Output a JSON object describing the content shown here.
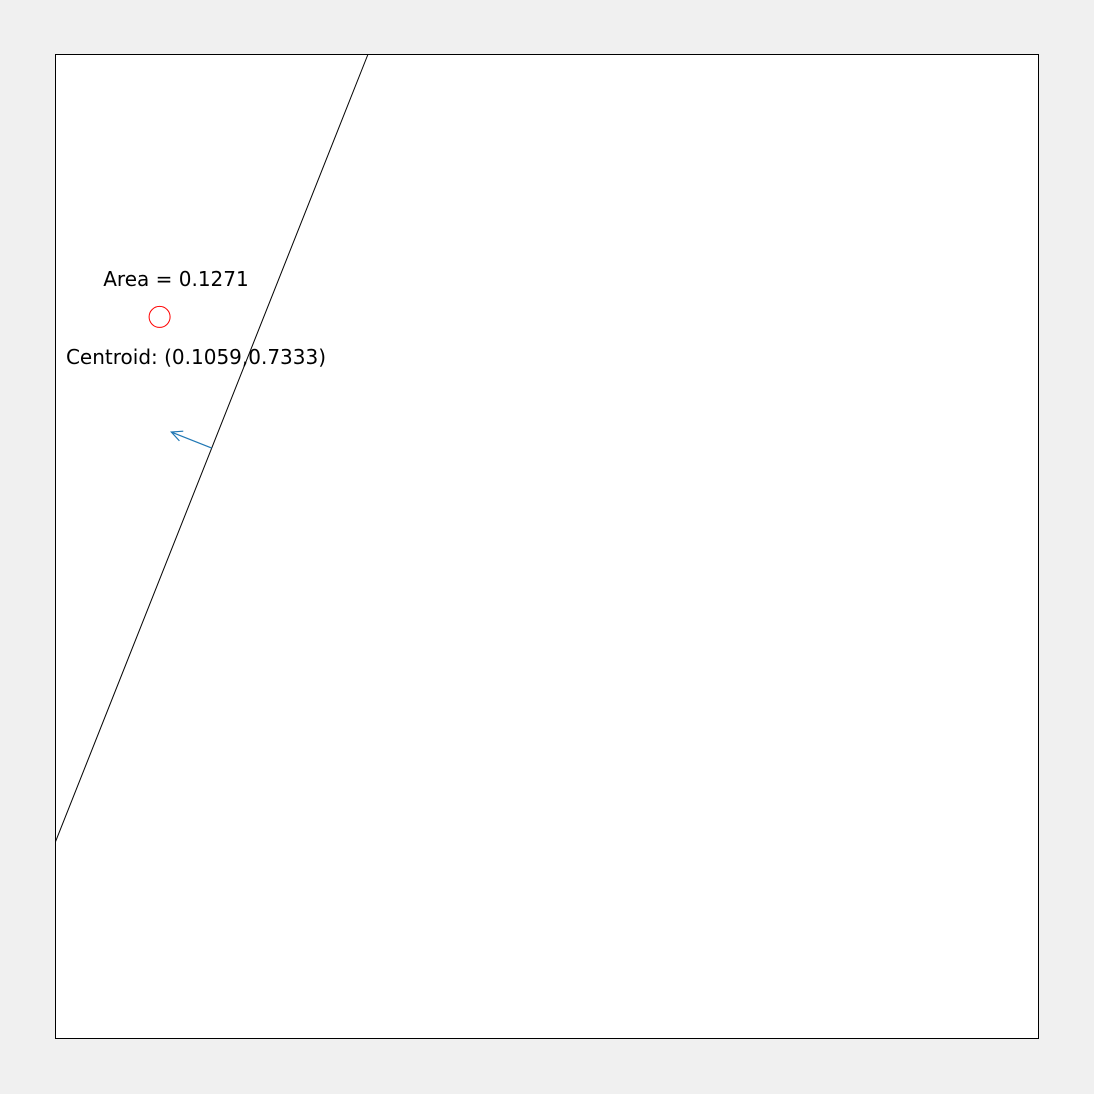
{
  "annotations": {
    "area_label": "Area = 0.1271",
    "centroid_label": "Centroid: (0.1059,0.7333)"
  },
  "geometry": {
    "domain": [
      [
        0,
        1
      ],
      [
        0,
        1
      ]
    ],
    "dividing_line": {
      "from": [
        0,
        0.2
      ],
      "to": [
        0.3178,
        1
      ]
    },
    "centroid": [
      0.1059,
      0.7333
    ],
    "normal_vector": {
      "from": [
        0.1589,
        0.6
      ],
      "to": [
        0.1178,
        0.6163
      ]
    }
  },
  "colors": {
    "background": "#f0f0f0",
    "plot_area": "#ffffff",
    "frame": "#000000",
    "line": "#000000",
    "centroid_marker": "#ff0000",
    "normal_arrow": "#1f77b4"
  }
}
